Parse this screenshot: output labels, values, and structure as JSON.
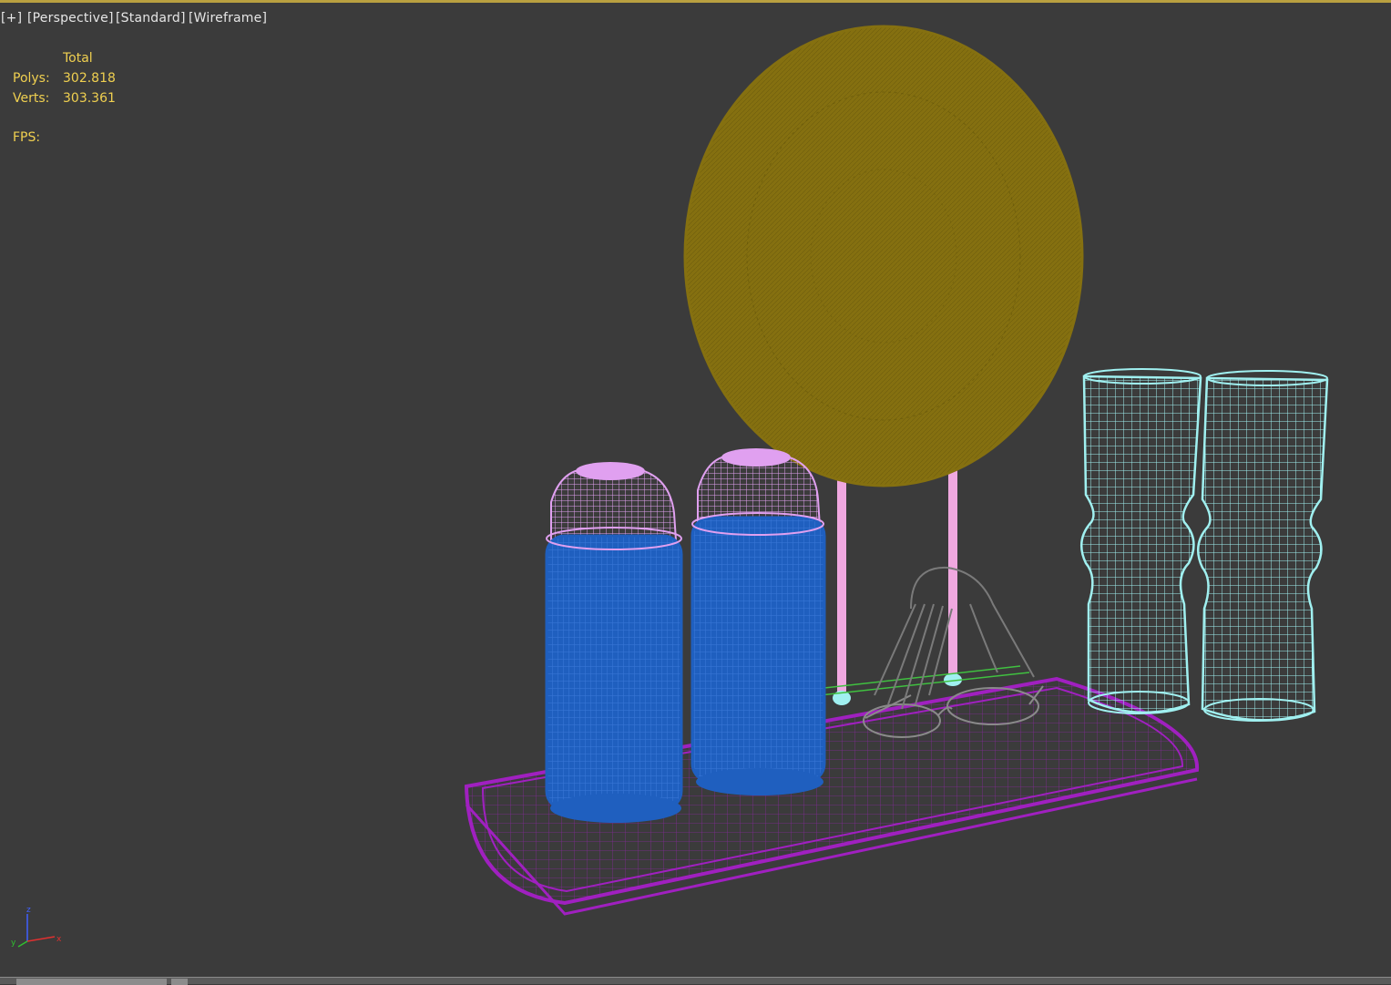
{
  "viewport": {
    "labels": {
      "plus": "[+]",
      "view": "[Perspective]",
      "shading_mode": "[Standard]",
      "render_mode": "[Wireframe]"
    },
    "stats": {
      "column_header": "Total",
      "polys_label": "Polys:",
      "polys_value": "302.818",
      "verts_label": "Verts:",
      "verts_value": "303.361",
      "fps_label": "FPS:"
    },
    "axis_gizmo": {
      "x": "x",
      "y": "y",
      "z": "z"
    },
    "colors": {
      "background": "#3b3b3b",
      "active_border": "#b9a040",
      "stats_text": "#f0d050",
      "label_text": "#e6e6e6",
      "mirror": "#857010",
      "mirror_stand": "#f0a8e0",
      "bottle_cap": "#e0a0f0",
      "bottle_body": "#1f5fbf",
      "tray": "#a020c0",
      "vase": "#a0f0f0",
      "comb": "#7a7a7a",
      "glasses": "#8a8a8a"
    },
    "objects": [
      {
        "name": "round-mirror"
      },
      {
        "name": "spray-bottle-left"
      },
      {
        "name": "spray-bottle-right"
      },
      {
        "name": "tray"
      },
      {
        "name": "vase-left"
      },
      {
        "name": "vase-right"
      },
      {
        "name": "comb"
      },
      {
        "name": "eyeglasses"
      }
    ]
  }
}
